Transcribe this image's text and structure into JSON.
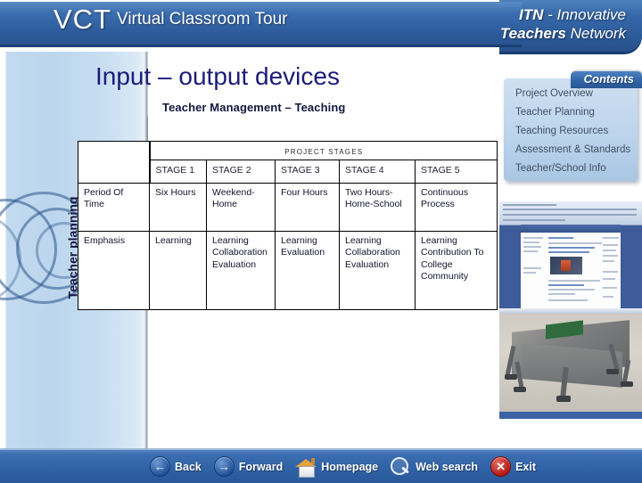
{
  "header": {
    "logo": "VCT",
    "logo_subtitle": "Virtual Classroom Tour",
    "brand_line1_bold": "ITN",
    "brand_line1_rest": " - Innovative",
    "brand_line2_bold": "Teachers",
    "brand_line2_rest": " Network",
    "bar_color": "#2d5a99"
  },
  "slide": {
    "title": "Input – output devices",
    "subtitle": "Teacher Management – Teaching",
    "title_color": "#1c1c7a",
    "vertical_axis_label": "Teacher planning"
  },
  "table": {
    "banner": "PROJECT STAGES",
    "corner_label": "",
    "stage_headers": [
      "STAGE 1",
      "STAGE 2",
      "STAGE 3",
      "STAGE 4",
      "STAGE 5"
    ],
    "rows": [
      {
        "label": "Period Of Time",
        "cells": [
          "Six Hours",
          "Weekend-Home",
          "Four Hours",
          "Two Hours-Home-School",
          "Continuous Process"
        ]
      },
      {
        "label": "Emphasis",
        "cells": [
          "Learning",
          "Learning Collaboration Evaluation",
          "Learning Evaluation",
          "Learning Collaboration Evaluation",
          "Learning Contribution To College Community"
        ]
      }
    ]
  },
  "contents": {
    "tab_label": "Contents",
    "items": [
      "Project Overview",
      "Teacher Planning",
      "Teaching  Resources",
      "Assessment & Standards",
      "Teacher/School Info"
    ]
  },
  "thumbnails": [
    {
      "name": "browser-screenshot-thumbnail"
    },
    {
      "name": "robot-photo-thumbnail"
    }
  ],
  "bottom_nav": {
    "items": [
      {
        "label": "Back",
        "icon": "arrow-left-icon"
      },
      {
        "label": "Forward",
        "icon": "arrow-right-icon"
      },
      {
        "label": "Homepage",
        "icon": "house-icon"
      },
      {
        "label": "Web search",
        "icon": "magnifier-icon"
      },
      {
        "label": "Exit",
        "icon": "close-x-icon"
      }
    ],
    "bar_color": "#2f61a6"
  }
}
